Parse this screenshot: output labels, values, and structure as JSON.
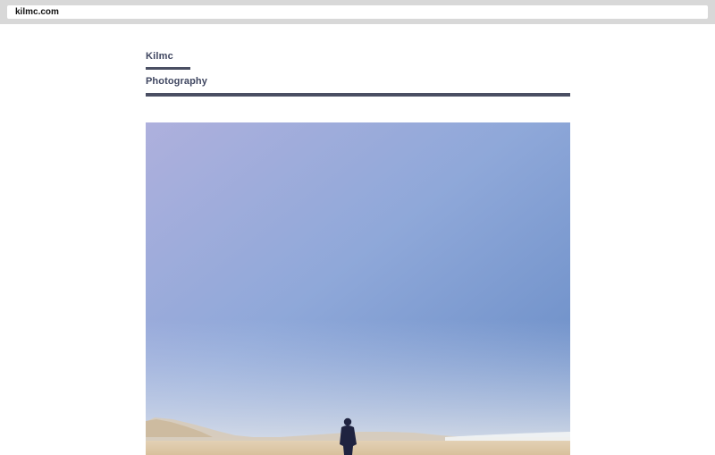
{
  "browser": {
    "url": "kilmc.com"
  },
  "site": {
    "title": "Kilmc",
    "nav": {
      "photography_label": "Photography"
    }
  },
  "photo": {
    "subject": "person-walking-on-beach-photo"
  },
  "colors": {
    "accent": "#4a4f63",
    "text": "#3f4660",
    "chrome": "#d8d8d8"
  }
}
